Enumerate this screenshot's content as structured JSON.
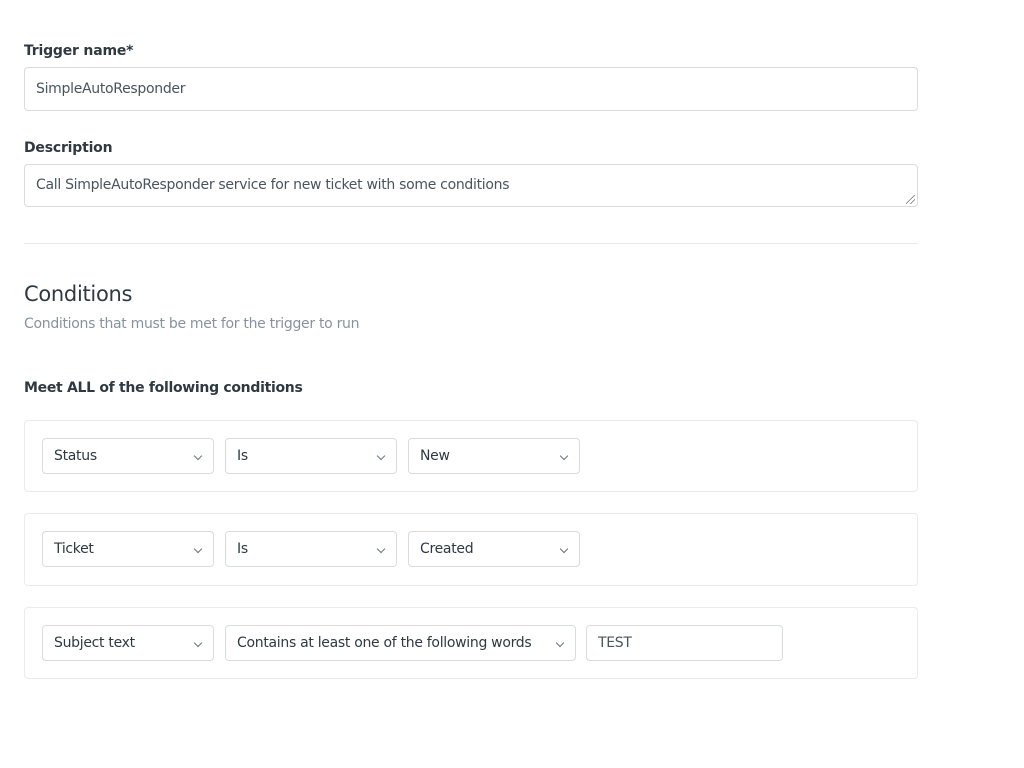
{
  "trigger_name": {
    "label": "Trigger name*",
    "value": "SimpleAutoResponder"
  },
  "description": {
    "label": "Description",
    "value": "Call SimpleAutoResponder service for new ticket with some conditions"
  },
  "conditions": {
    "title": "Conditions",
    "subtitle": "Conditions that must be met for the trigger to run",
    "meet_all_label": "Meet ALL of the following conditions",
    "rows": [
      {
        "field": "Status",
        "operator": "Is",
        "value": "New",
        "value_type": "select"
      },
      {
        "field": "Ticket",
        "operator": "Is",
        "value": "Created",
        "value_type": "select"
      },
      {
        "field": "Subject text",
        "operator": "Contains at least one of the following words",
        "value": "TEST",
        "value_type": "text"
      }
    ]
  },
  "icons": {
    "dropdown": "chevron-down-icon",
    "resize": "resize-grip-icon"
  }
}
